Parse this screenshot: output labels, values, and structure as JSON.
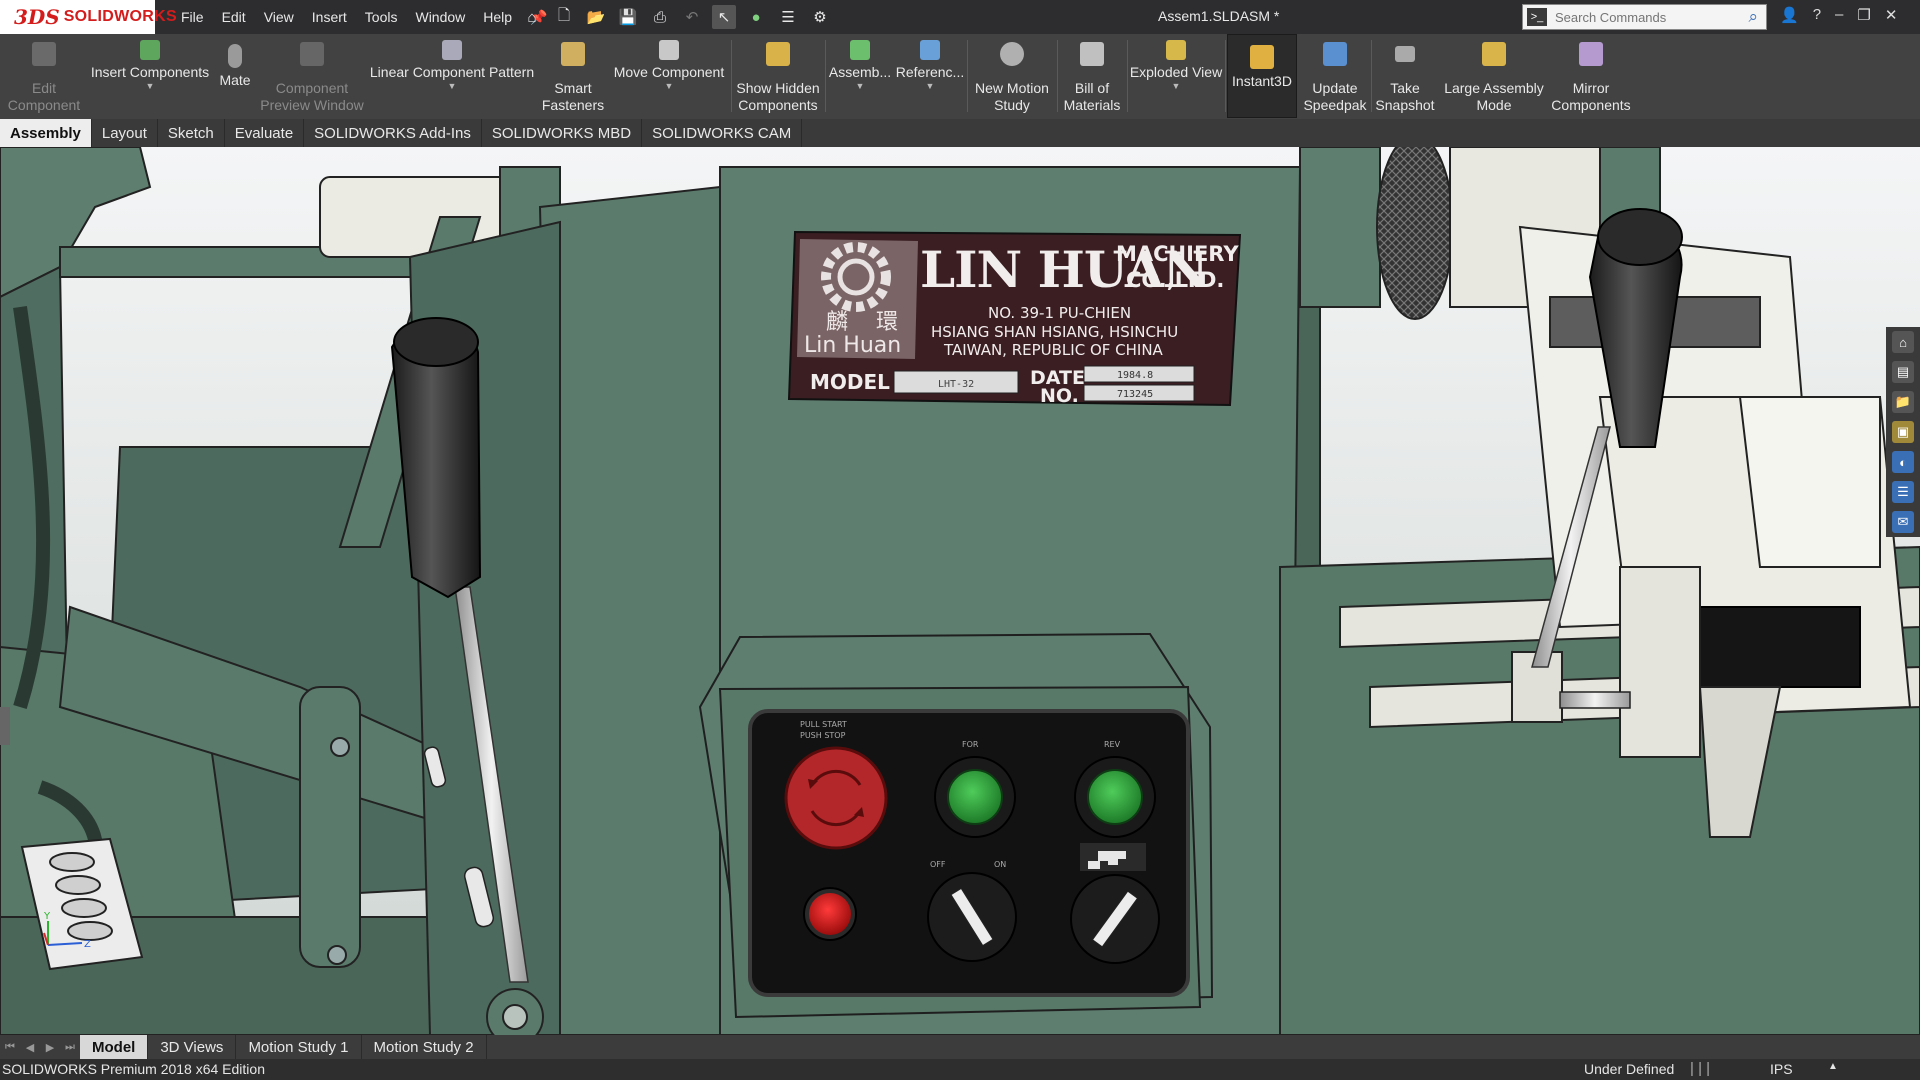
{
  "app": {
    "logo_mark": "3DS",
    "logo_text": "SOLIDWORKS",
    "document_title": "Assem1.SLDASM *"
  },
  "menu": [
    "File",
    "Edit",
    "View",
    "Insert",
    "Tools",
    "Window",
    "Help"
  ],
  "search": {
    "placeholder": "Search Commands"
  },
  "ribbon": {
    "edit_component": "Edit Component",
    "insert_components": "Insert Components",
    "mate": "Mate",
    "component_preview": "Component Preview Window",
    "linear_pattern": "Linear Component Pattern",
    "smart_fasteners": "Smart Fasteners",
    "move_component": "Move Component",
    "show_hidden": "Show Hidden Components",
    "assembly_features": "Assemb...",
    "reference_geometry": "Referenc...",
    "new_motion_study": "New Motion Study",
    "bill_of_materials": "Bill of Materials",
    "exploded_view": "Exploded View",
    "instant3d": "Instant3D",
    "update_speedpak": "Update Speedpak",
    "take_snapshot": "Take Snapshot",
    "large_assembly_mode": "Large Assembly Mode",
    "mirror_components": "Mirror Components"
  },
  "tabs": [
    "Assembly",
    "Layout",
    "Sketch",
    "Evaluate",
    "SOLIDWORKS Add-Ins",
    "SOLIDWORKS MBD",
    "SOLIDWORKS CAM"
  ],
  "nameplate": {
    "company": "LIN HUAN",
    "company_suffix_1": "MACHIERY",
    "company_suffix_2": "CO.,LTD.",
    "logo_chinese_1": "麟",
    "logo_chinese_2": "環",
    "logo_english": "Lin Huan",
    "address_1": "NO. 39-1 PU-CHIEN",
    "address_2": "HSIANG SHAN HSIANG, HSINCHU",
    "address_3": "TAIWAN, REPUBLIC OF CHINA",
    "model_label": "MODEL",
    "model_value": "LHT-32",
    "date_label": "DATE",
    "no_label": "NO.",
    "date_value": "1984.8",
    "no_value": "713245"
  },
  "control_panel": {
    "estop_label_1": "PULL START",
    "estop_label_2": "PUSH STOP",
    "fwd_label": "FOR",
    "rev_label": "REV",
    "off_label": "OFF",
    "on_label": "ON"
  },
  "bottom_tabs": [
    "Model",
    "3D Views",
    "Motion Study 1",
    "Motion Study 2"
  ],
  "status": {
    "edition": "SOLIDWORKS Premium 2018 x64 Edition",
    "definition": "Under Defined",
    "units": "IPS"
  },
  "colors": {
    "machine_green": "#5b7b6d",
    "machine_green_dark": "#3f5a4f",
    "plate_maroon": "#3a1e22",
    "button_green": "#2e9a3c",
    "estop_red": "#b3262a",
    "accent_red": "#d41c1c"
  }
}
